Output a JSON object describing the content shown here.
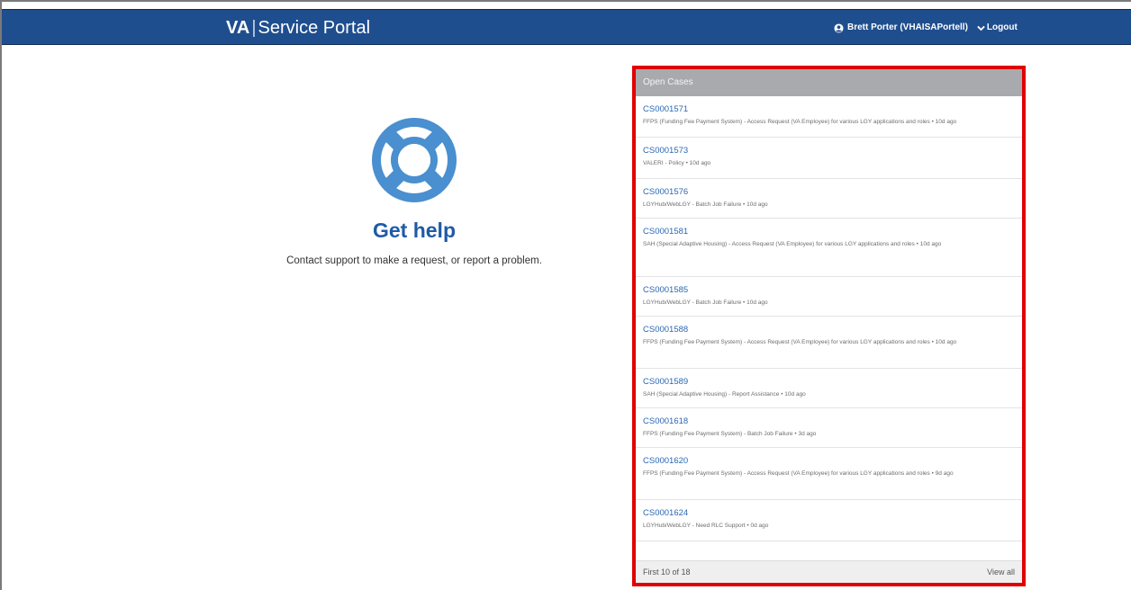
{
  "header": {
    "brand_short": "VA",
    "brand_separator": "|",
    "brand_title": "Service Portal",
    "user_name": "Brett Porter (VHAISAPortell)",
    "logout_label": "Logout"
  },
  "help": {
    "icon": "lifebuoy-icon",
    "title": "Get help",
    "description": "Contact support to make a request, or report a problem."
  },
  "open_cases": {
    "header": "Open Cases",
    "items": [
      {
        "number": "CS0001571",
        "description": "FFPS (Funding Fee Payment System) - Access Request (VA Employee) for various LGY applications and roles",
        "age": "10d ago"
      },
      {
        "number": "CS0001573",
        "description": "VALERI - Policy",
        "age": "10d ago"
      },
      {
        "number": "CS0001576",
        "description": "LGYHub/WebLGY - Batch Job Failure",
        "age": "10d ago"
      },
      {
        "number": "CS0001581",
        "description": "SAH (Special Adaptive Housing) - Access Request (VA Employee) for various LGY applications and roles",
        "age": "10d ago"
      },
      {
        "number": "CS0001585",
        "description": "LGYHub/WebLGY - Batch Job Failure",
        "age": "10d ago"
      },
      {
        "number": "CS0001588",
        "description": "FFPS (Funding Fee Payment System) - Access Request (VA Employee) for various LGY applications and roles",
        "age": "10d ago"
      },
      {
        "number": "CS0001589",
        "description": "SAH (Special Adaptive Housing) - Report Assistance",
        "age": "10d ago"
      },
      {
        "number": "CS0001618",
        "description": "FFPS (Funding Fee Payment System) - Batch Job Failure",
        "age": "3d ago"
      },
      {
        "number": "CS0001620",
        "description": "FFPS (Funding Fee Payment System) - Access Request (VA Employee) for various LGY applications and roles",
        "age": "9d ago"
      },
      {
        "number": "CS0001624",
        "description": "LGYHub/WebLGY - Need RLC Support",
        "age": "0d ago"
      }
    ],
    "separator": "•",
    "count_text": "First 10 of 18",
    "view_all_label": "View all"
  },
  "colors": {
    "header_bg": "#1f4e8e",
    "accent_blue": "#1f5aa6",
    "highlight_border": "#e00000",
    "panel_header_bg": "#a8aaad"
  }
}
